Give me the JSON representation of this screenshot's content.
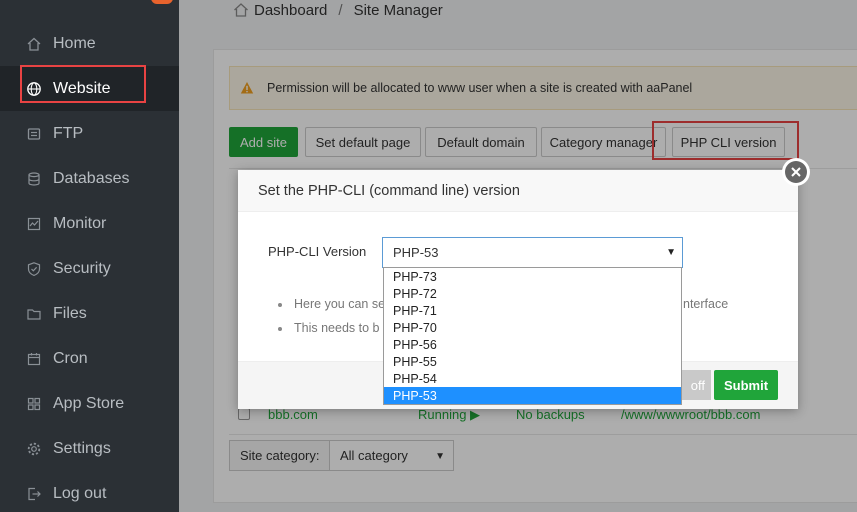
{
  "sidebar": {
    "items": [
      {
        "label": "Home",
        "icon": "home-icon"
      },
      {
        "label": "Website",
        "icon": "globe-icon",
        "active": true
      },
      {
        "label": "FTP",
        "icon": "ftp-icon"
      },
      {
        "label": "Databases",
        "icon": "database-icon"
      },
      {
        "label": "Monitor",
        "icon": "monitor-icon"
      },
      {
        "label": "Security",
        "icon": "shield-icon"
      },
      {
        "label": "Files",
        "icon": "folder-icon"
      },
      {
        "label": "Cron",
        "icon": "calendar-icon"
      },
      {
        "label": "App Store",
        "icon": "app-store-icon"
      },
      {
        "label": "Settings",
        "icon": "gear-icon"
      },
      {
        "label": "Log out",
        "icon": "logout-icon"
      }
    ]
  },
  "breadcrumb": {
    "items": [
      "Dashboard",
      "Site Manager"
    ],
    "separator": "/"
  },
  "alert": {
    "text": "Permission will be allocated to www user when a site is created with aaPanel"
  },
  "toolbar": {
    "add_site": "Add site",
    "set_default_page": "Set default page",
    "default_domain": "Default domain",
    "category_manager": "Category manager",
    "php_cli_version": "PHP CLI version"
  },
  "site_row": {
    "name": "bbb.com",
    "status": "Running ▶",
    "backup": "No backups",
    "path": "/www/wwwroot/bbb.com"
  },
  "filter": {
    "label": "Site category:",
    "value": "All category"
  },
  "modal": {
    "title": "Set the PHP-CLI (command line) version",
    "field_label": "PHP-CLI Version",
    "selected_value": "PHP-53",
    "options": [
      "PHP-73",
      "PHP-72",
      "PHP-71",
      "PHP-70",
      "PHP-56",
      "PHP-55",
      "PHP-54",
      "PHP-53"
    ],
    "hint1_start": "Here you can se",
    "hint1_end": "nterface",
    "hint2_start": "This needs to b",
    "off_label": "off",
    "submit_label": "Submit"
  },
  "colors": {
    "accent_green": "#20a53a",
    "highlight_red": "#e84343",
    "sidebar_bg": "#2b3035",
    "selected_blue": "#1e90ff",
    "running_green": "#20a53a"
  }
}
